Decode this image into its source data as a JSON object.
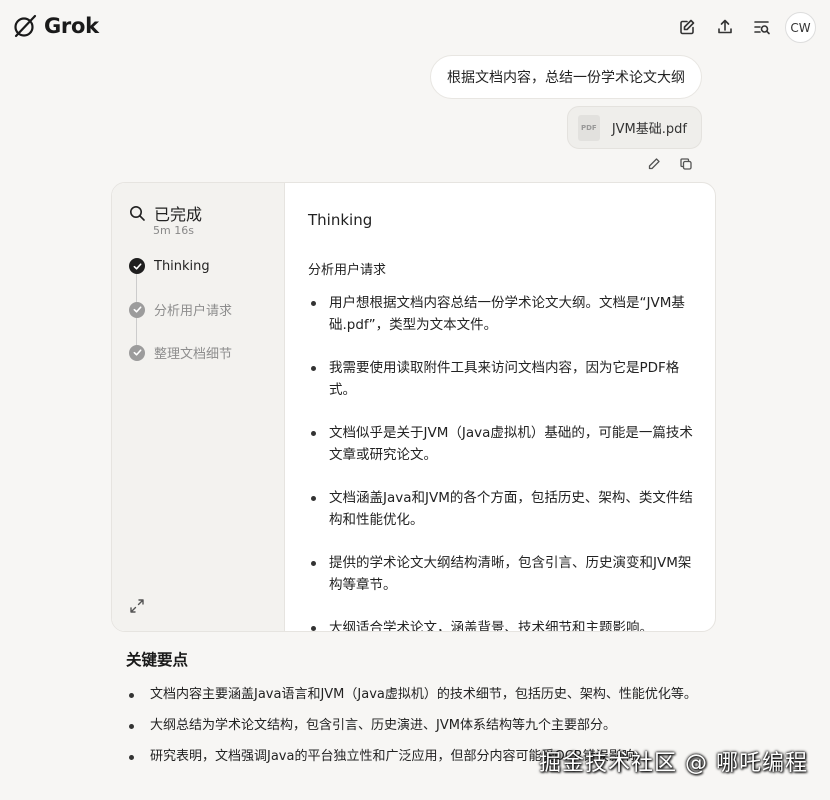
{
  "app": {
    "name": "Grok"
  },
  "header": {
    "avatar_initials": "CW"
  },
  "user_message": {
    "text": "根据文档内容，总结一份学术论文大纲",
    "attachment": {
      "icon_label": "PDF",
      "filename": "JVM基础.pdf"
    }
  },
  "thinking": {
    "status": "已完成",
    "duration": "5m 16s",
    "steps": [
      {
        "label": "Thinking"
      },
      {
        "label": "分析用户请求"
      },
      {
        "label": "整理文档细节"
      }
    ],
    "title": "Thinking",
    "subtitle": "分析用户请求",
    "bullets": [
      "用户想根据文档内容总结一份学术论文大纲。文档是“JVM基础.pdf”，类型为文本文件。",
      "我需要使用读取附件工具来访问文档内容，因为它是PDF格式。",
      "文档似乎是关于JVM（Java虚拟机）基础的，可能是一篇技术文章或研究论文。",
      "文档涵盖Java和JVM的各个方面，包括历史、架构、类文件结构和性能优化。",
      "提供的学术论文大纲结构清晰，包含引言、历史演变和JVM架构等章节。",
      "大纲适合学术论文，涵盖背景、技术细节和主题影响。"
    ]
  },
  "key_points": {
    "title": "关键要点",
    "items": [
      "文档内容主要涵盖Java语言和JVM（Java虚拟机）的技术细节，包括历史、架构、性能优化等。",
      "大纲总结为学术论文结构，包含引言、历史演进、JVM体系结构等九个主要部分。",
      "研究表明，文档强调Java的平台独立性和广泛应用，但部分内容可能受OCR错误影响。"
    ]
  },
  "watermark": "掘金技术社区 @ 哪吒编程"
}
